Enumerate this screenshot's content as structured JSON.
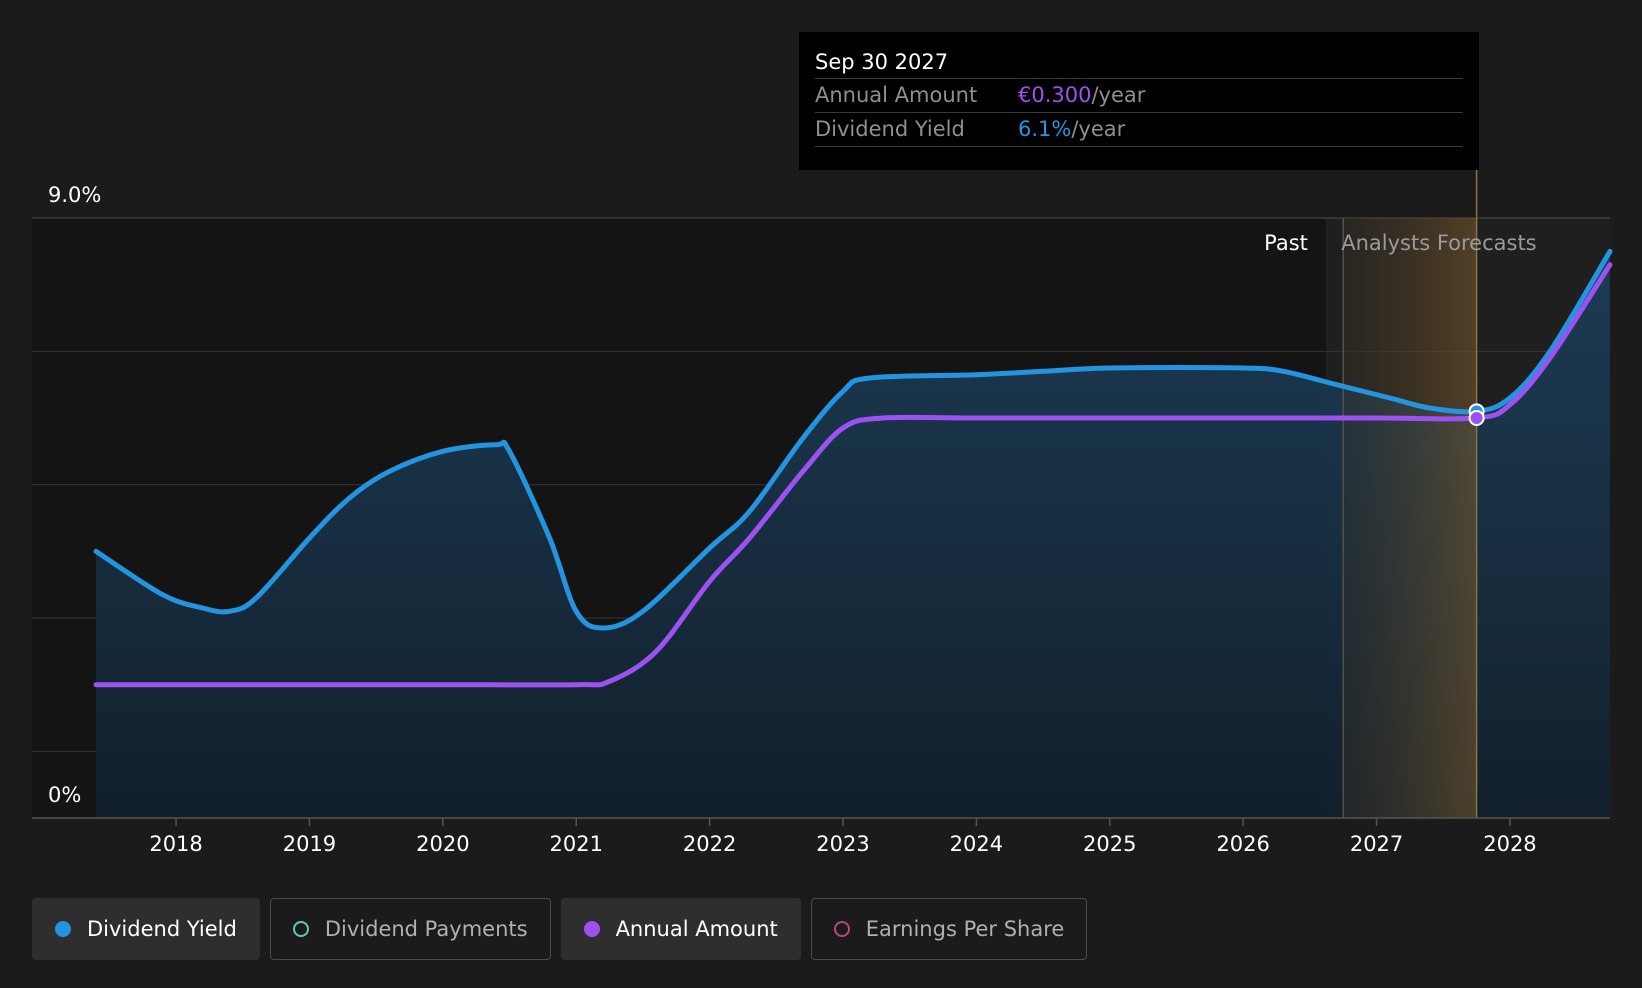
{
  "chart_data": {
    "type": "area",
    "x_ticks": [
      "2018",
      "2019",
      "2020",
      "2021",
      "2022",
      "2023",
      "2024",
      "2025",
      "2026",
      "2027",
      "2028"
    ],
    "x_range": [
      2016.92,
      2028.75
    ],
    "y_tick_labels": [
      "9.0%",
      "0%"
    ],
    "ylim": [
      0,
      9.0
    ],
    "grid": true,
    "regions": {
      "past_label": "Past",
      "forecast_label": "Analysts Forecasts",
      "past_end": 2026.62,
      "forecast_band": [
        2026.75,
        2027.75
      ]
    },
    "series": [
      {
        "name": "Dividend Yield",
        "color": "#2394df",
        "x": [
          2017.4,
          2017.9,
          2018.2,
          2018.4,
          2018.6,
          2019.0,
          2019.3,
          2019.6,
          2020.0,
          2020.4,
          2020.5,
          2020.8,
          2021.0,
          2021.2,
          2021.5,
          2022.0,
          2022.3,
          2022.7,
          2023.0,
          2023.2,
          2024.0,
          2024.5,
          2025.0,
          2026.0,
          2026.3,
          2026.7,
          2027.1,
          2027.4,
          2027.75,
          2028.0,
          2028.3,
          2028.75
        ],
        "values": [
          4.0,
          3.35,
          3.15,
          3.1,
          3.3,
          4.2,
          4.8,
          5.2,
          5.5,
          5.6,
          5.5,
          4.2,
          3.1,
          2.85,
          3.1,
          4.05,
          4.6,
          5.7,
          6.4,
          6.6,
          6.65,
          6.7,
          6.75,
          6.75,
          6.7,
          6.5,
          6.3,
          6.15,
          6.1,
          6.3,
          7.0,
          8.5
        ]
      },
      {
        "name": "Annual Amount",
        "color": "#9c52f0",
        "x": [
          2017.4,
          2018.0,
          2019.0,
          2020.0,
          2021.0,
          2021.25,
          2021.6,
          2022.0,
          2022.3,
          2022.7,
          2023.0,
          2023.3,
          2024.0,
          2025.0,
          2026.0,
          2027.0,
          2027.75,
          2028.0,
          2028.3,
          2028.75
        ],
        "values": [
          2.0,
          2.0,
          2.0,
          2.0,
          2.0,
          2.05,
          2.5,
          3.55,
          4.2,
          5.2,
          5.85,
          6.0,
          6.0,
          6.0,
          6.0,
          6.0,
          6.0,
          6.2,
          6.9,
          8.3
        ]
      }
    ],
    "tooltip": {
      "date": "Sep 30 2027",
      "x": 2027.75,
      "rows": [
        {
          "label": "Annual Amount",
          "value": "€0.300",
          "unit": "/year",
          "color": "#9c52f0"
        },
        {
          "label": "Dividend Yield",
          "value": "6.1%",
          "unit": "/year",
          "color": "#2394df"
        }
      ]
    },
    "legend": [
      {
        "label": "Dividend Yield",
        "color": "#2394df",
        "active": true
      },
      {
        "label": "Dividend Payments",
        "color": "#5fc9b9",
        "active": false
      },
      {
        "label": "Annual Amount",
        "color": "#9c52f0",
        "active": true
      },
      {
        "label": "Earnings Per Share",
        "color": "#b8487e",
        "active": false
      }
    ]
  }
}
